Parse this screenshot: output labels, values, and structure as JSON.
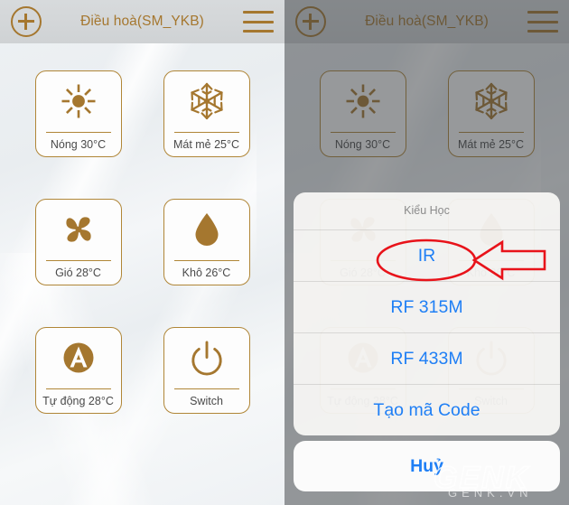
{
  "header": {
    "title": "Điều hoà(SM_YKB)",
    "add_icon": "plus-circle-icon",
    "menu_icon": "hamburger-menu-icon"
  },
  "colors": {
    "gold": "#a5772f",
    "tile_border": "#b08637",
    "blue": "#1f7ff5",
    "annotation_red": "#e8131a",
    "green_bar": "#2ec544",
    "background": "#eef1f4",
    "dim_overlay": "rgba(58,62,65,0.52)"
  },
  "modes": [
    {
      "icon": "sun-icon",
      "label": "Nóng 30°C"
    },
    {
      "icon": "snowflake-icon",
      "label": "Mát mẻ 25°C"
    },
    {
      "icon": "fan-icon",
      "label": "Gió 28°C"
    },
    {
      "icon": "water-drop-icon",
      "label": "Khô 26°C"
    },
    {
      "icon": "auto-a-icon",
      "label": "Tự động 28°C"
    },
    {
      "icon": "power-icon",
      "label": "Switch"
    }
  ],
  "sheet": {
    "title": "Kiểu Học",
    "options": [
      {
        "label": "IR",
        "highlighted": true
      },
      {
        "label": "RF 315M",
        "highlighted": false
      },
      {
        "label": "RF 433M",
        "highlighted": false
      },
      {
        "label": "Tạo mã Code",
        "highlighted": false
      }
    ],
    "cancel_label": "Huỷ"
  },
  "annotation": {
    "ellipse_target": "IR",
    "arrow": "left-pointing-arrow"
  },
  "watermark": {
    "main": "GENK",
    "sub": "GENK.VN"
  }
}
